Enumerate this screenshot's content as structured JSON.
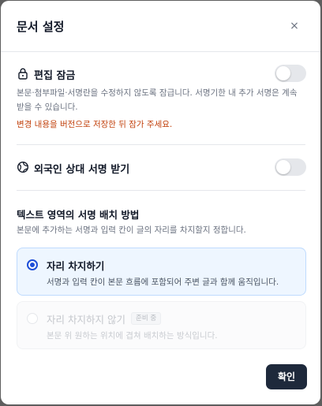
{
  "dialog": {
    "title": "문서 설정",
    "close_label": "×"
  },
  "edit_lock": {
    "label": "편집 잠금",
    "icon": "lock-icon",
    "enabled": false,
    "desc_line1": "본문·첨부파일·서명란을 수정하지 않도록 잠급니다. 서명기한 내 추가 서명은 계속",
    "desc_line2": "받을 수 있습니다.",
    "warning": "변경 내용을 버전으로 저장한 뒤 잠가 주세요."
  },
  "foreign_signer": {
    "label": "외국인 상대 서명 받기",
    "icon": "globe-icon",
    "enabled": false
  },
  "text_area": {
    "title": "텍스트 영역의 서명 배치 방법",
    "desc": "본문에 추가하는 서명과 입력 칸이 글의 자리를 차지할지 정합니다.",
    "options": [
      {
        "label": "자리 차지하기",
        "desc": "서명과 입력 칸이 본문 흐름에 포함되어 주변 글과 함께 움직입니다.",
        "selected": true
      },
      {
        "label": "자리 차지하지 않기",
        "badge": "준비 중",
        "desc": "본문 위 원하는 위치에 겹쳐 배치하는 방식입니다.",
        "selected": false,
        "disabled": true
      }
    ]
  },
  "footer": {
    "confirm_label": "확인"
  },
  "colors": {
    "primary": "#1e293b",
    "radio_active": "#1d4ed8",
    "warning": "#c2410c"
  }
}
